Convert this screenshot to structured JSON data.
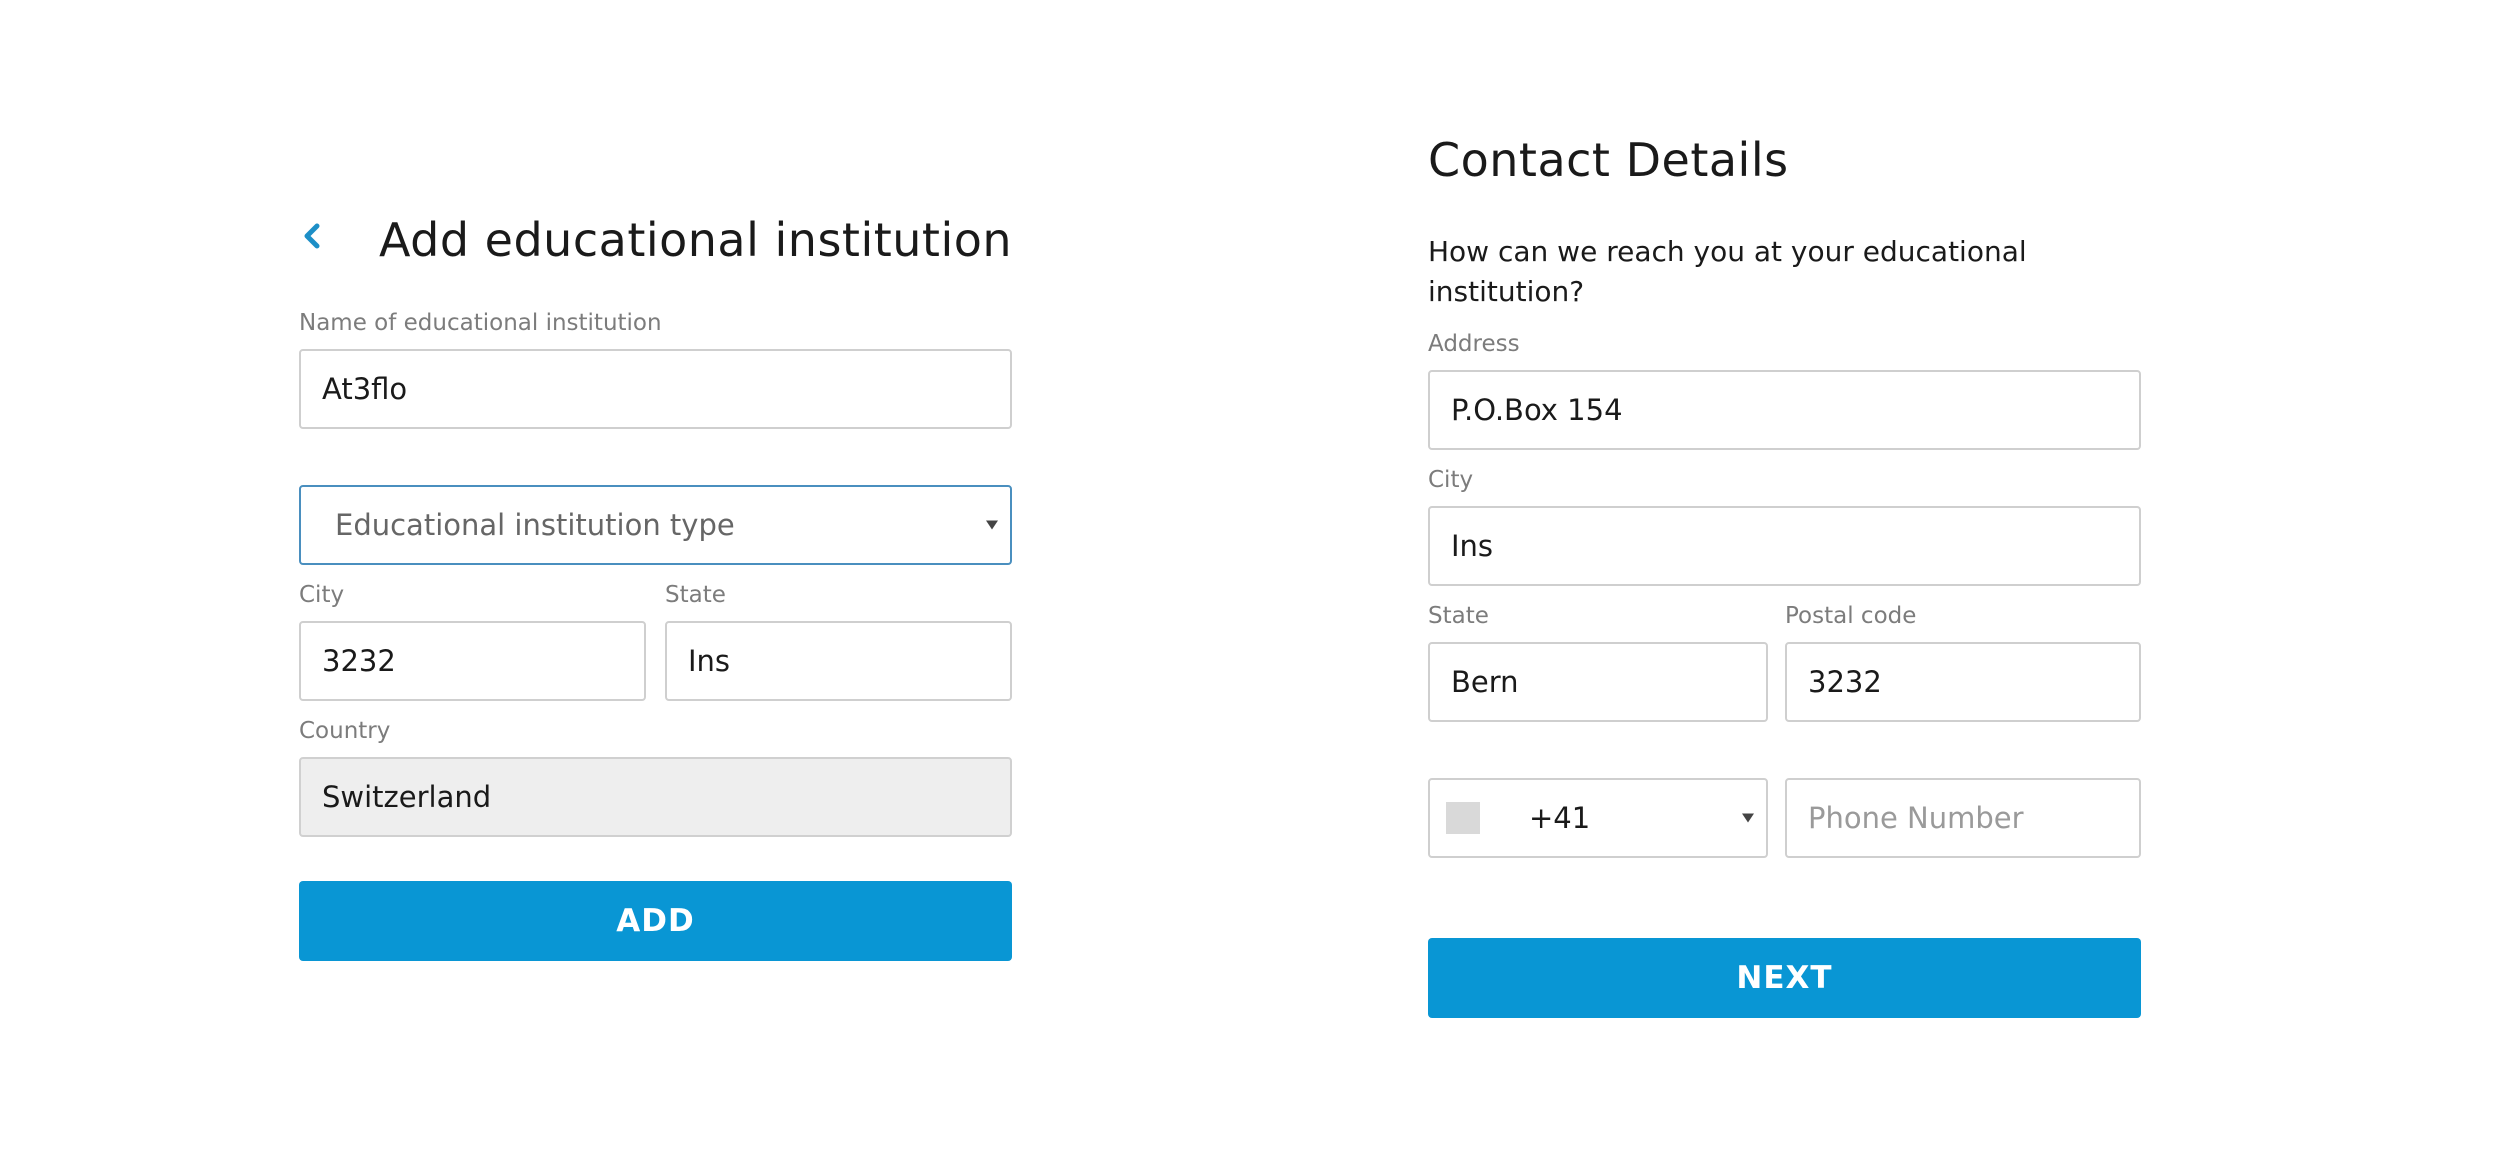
{
  "left_form": {
    "title": "Add educational institution",
    "back_icon": "chevron-left-icon",
    "name_label": "Name of educational institution",
    "name_value": "At3flo",
    "type_select": "Educational institution type",
    "city_label": "City",
    "city_value": "3232",
    "state_label": "State",
    "state_value": "Ins",
    "country_label": "Country",
    "country_value": "Switzerland",
    "add_button": "ADD"
  },
  "right_form": {
    "title": "Contact Details",
    "subtitle": "How can we reach you at your educational institution?",
    "address_label": "Address",
    "address_value": "P.O.Box 154",
    "city_label": "City",
    "city_value": "Ins",
    "state_label": "State",
    "state_value": "Bern",
    "postal_label": "Postal code",
    "postal_value": "3232",
    "dial_code": "+41",
    "phone_placeholder": "Phone Number",
    "next_button": "NEXT"
  },
  "colors": {
    "accent": "#0996d4",
    "back_chevron": "#1d8fc7",
    "select_border": "#4a8fbf",
    "disabled_bg": "#eeeeee"
  }
}
